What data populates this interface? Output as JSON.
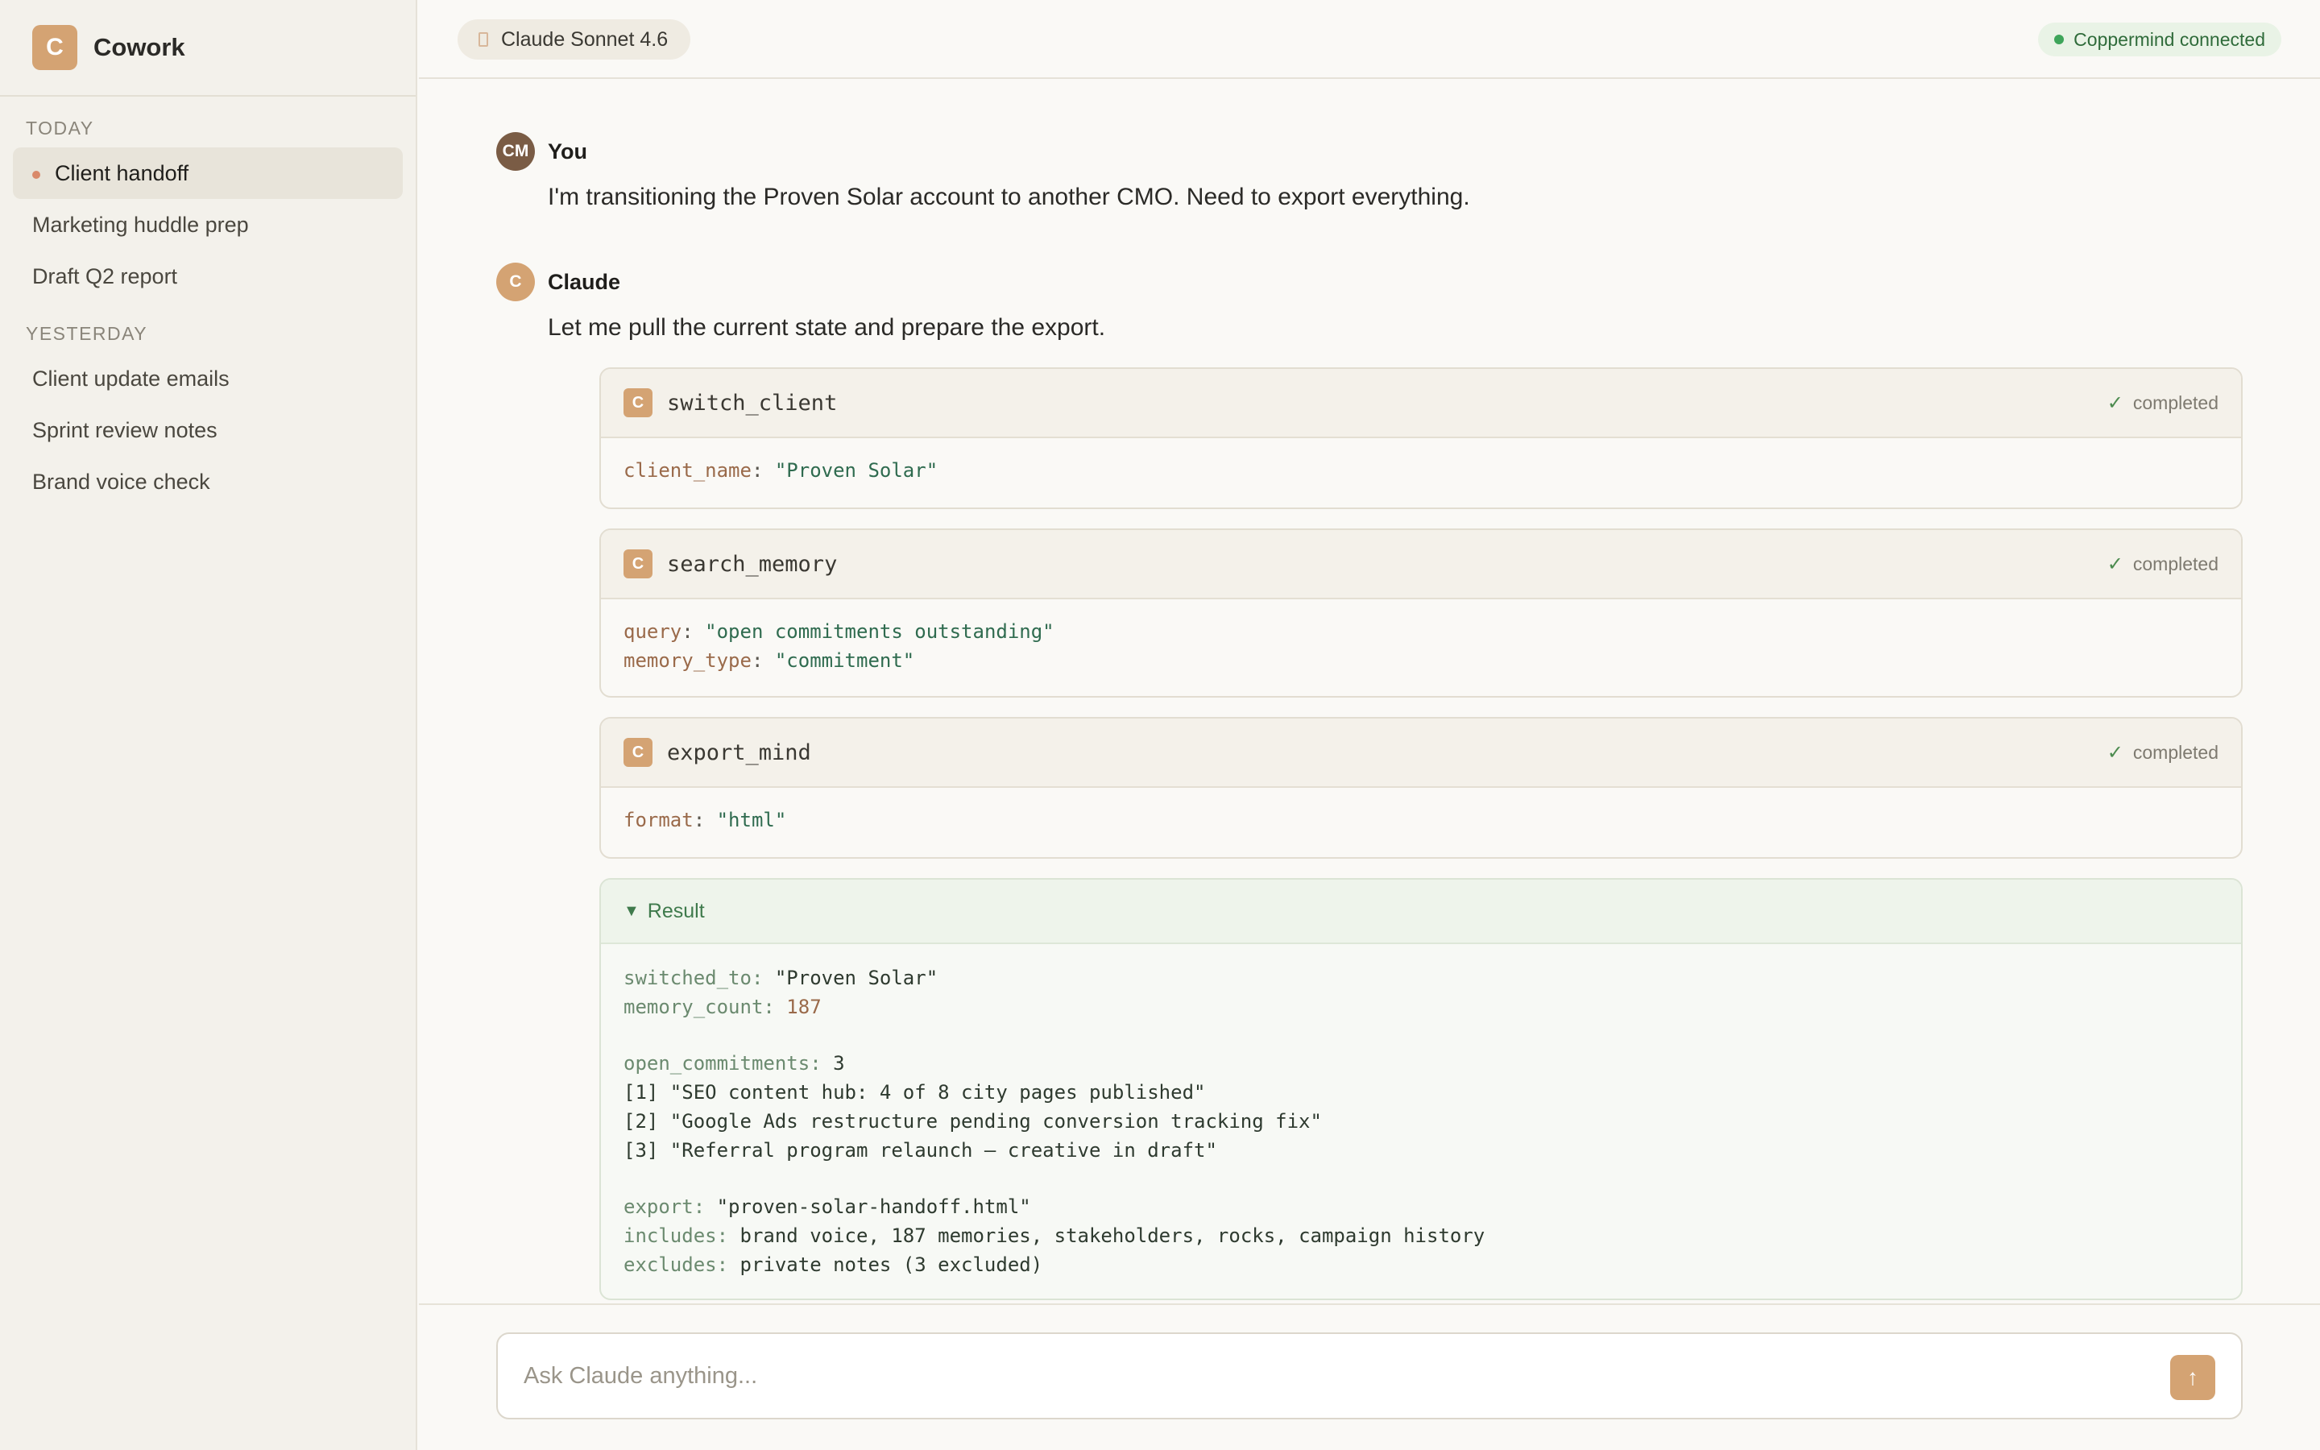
{
  "app": {
    "logo_letter": "C",
    "name": "Cowork"
  },
  "sidebar": {
    "sections": [
      {
        "label": "TODAY",
        "items": [
          "Client handoff",
          "Marketing huddle prep",
          "Draft Q2 report"
        ]
      },
      {
        "label": "YESTERDAY",
        "items": [
          "Client update emails",
          "Sprint review notes",
          "Brand voice check"
        ]
      }
    ],
    "active_item": "Client handoff"
  },
  "topbar": {
    "model": "Claude Sonnet 4.6",
    "connection": "Coppermind connected"
  },
  "messages": {
    "user": {
      "initials": "CM",
      "author": "You",
      "text": "I'm transitioning the Proven Solar account to another CMO. Need to export everything."
    },
    "assistant": {
      "initial": "C",
      "author": "Claude",
      "text": "Let me pull the current state and prepare the export."
    }
  },
  "tools": [
    {
      "icon_letter": "C",
      "name": "switch_client",
      "status": "completed",
      "params": [
        {
          "key": "client_name",
          "value": "\"Proven Solar\""
        }
      ]
    },
    {
      "icon_letter": "C",
      "name": "search_memory",
      "status": "completed",
      "params": [
        {
          "key": "query",
          "value": "\"open commitments outstanding\""
        },
        {
          "key": "memory_type",
          "value": "\"commitment\""
        }
      ]
    },
    {
      "icon_letter": "C",
      "name": "export_mind",
      "status": "completed",
      "params": [
        {
          "key": "format",
          "value": "\"html\""
        }
      ]
    }
  ],
  "result": {
    "label": "Result",
    "switched_to_key": "switched_to",
    "switched_to": "\"Proven Solar\"",
    "memory_count_key": "memory_count",
    "memory_count": "187",
    "open_commitments_key": "open_commitments",
    "open_commitments": "3",
    "commitments": [
      "[1] \"SEO content hub: 4 of 8 city pages published\"",
      "[2] \"Google Ads restructure pending conversion tracking fix\"",
      "[3] \"Referral program relaunch — creative in draft\""
    ],
    "export_key": "export",
    "export": "\"proven-solar-handoff.html\"",
    "includes_key": "includes",
    "includes": "brand voice, 187 memories, stakeholders, rocks, campaign history",
    "excludes_key": "excludes",
    "excludes": "private notes (3 excluded)"
  },
  "composer": {
    "placeholder": "Ask Claude anything...",
    "send_icon": "arrow-up-icon"
  },
  "colors": {
    "accent": "#d4a373",
    "success": "#3ea55a",
    "sidebar_bg": "#f3f1eb",
    "page_bg": "#faf9f6"
  }
}
